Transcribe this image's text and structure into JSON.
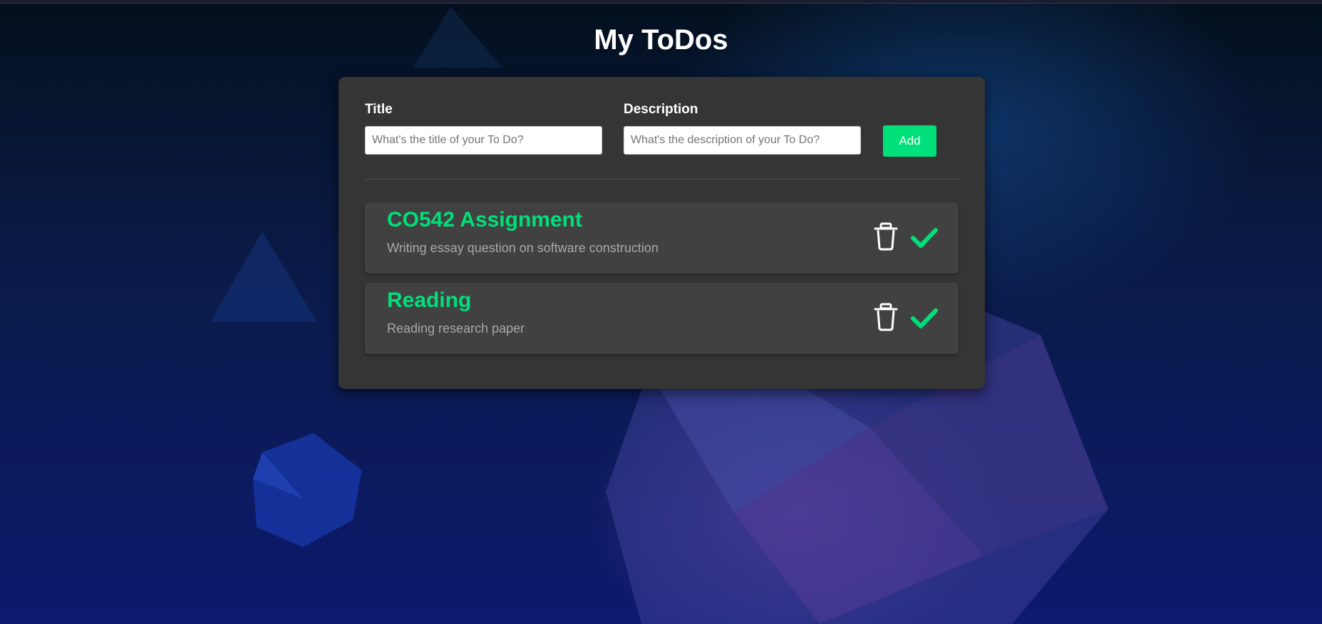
{
  "page": {
    "title": "My ToDos"
  },
  "form": {
    "title_label": "Title",
    "title_placeholder": "What's the title of your To Do?",
    "title_value": "",
    "description_label": "Description",
    "description_placeholder": "What's the description of your To Do?",
    "description_value": "",
    "add_label": "Add"
  },
  "todos": [
    {
      "title": "CO542 Assignment",
      "description": "Writing essay question on software construction"
    },
    {
      "title": "Reading",
      "description": "Reading research paper"
    }
  ],
  "icons": {
    "delete": "trash-icon",
    "complete": "check-icon"
  },
  "colors": {
    "accent": "#00e07a",
    "panel": "#353535",
    "item": "#414141"
  }
}
